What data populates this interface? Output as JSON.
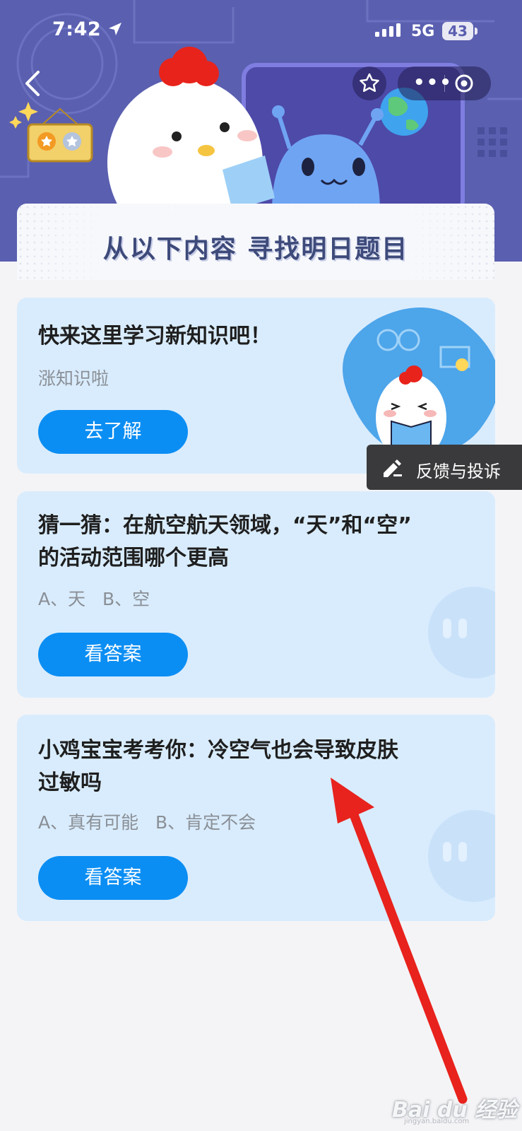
{
  "status_bar": {
    "time": "7:42",
    "network": "5G",
    "battery": "43"
  },
  "banner": {
    "title": "从以下内容 寻找明日题目"
  },
  "cards": [
    {
      "title": "快来这里学习新知识吧！",
      "subtitle": "涨知识啦",
      "button": "去了解"
    },
    {
      "title_line1": "猜一猜：在航空航天领域，“天”和“空”",
      "title_line2": "的活动范围哪个更高",
      "options": "A、天   B、空",
      "button": "看答案"
    },
    {
      "title_line1": "小鸡宝宝考考你：冷空气也会导致皮肤",
      "title_line2": "过敏吗",
      "options": "A、真有可能   B、肯定不会",
      "button": "看答案"
    }
  ],
  "feedback": {
    "label": "反馈与投诉"
  },
  "watermark": {
    "brand": "Bai du 经验",
    "url": "jingyan.baidu.com"
  },
  "colors": {
    "header_bg": "#5a5fb0",
    "card_bg": "#d9ecfd",
    "button_bg": "#0b8ef3",
    "arrow": "#e8221d"
  }
}
